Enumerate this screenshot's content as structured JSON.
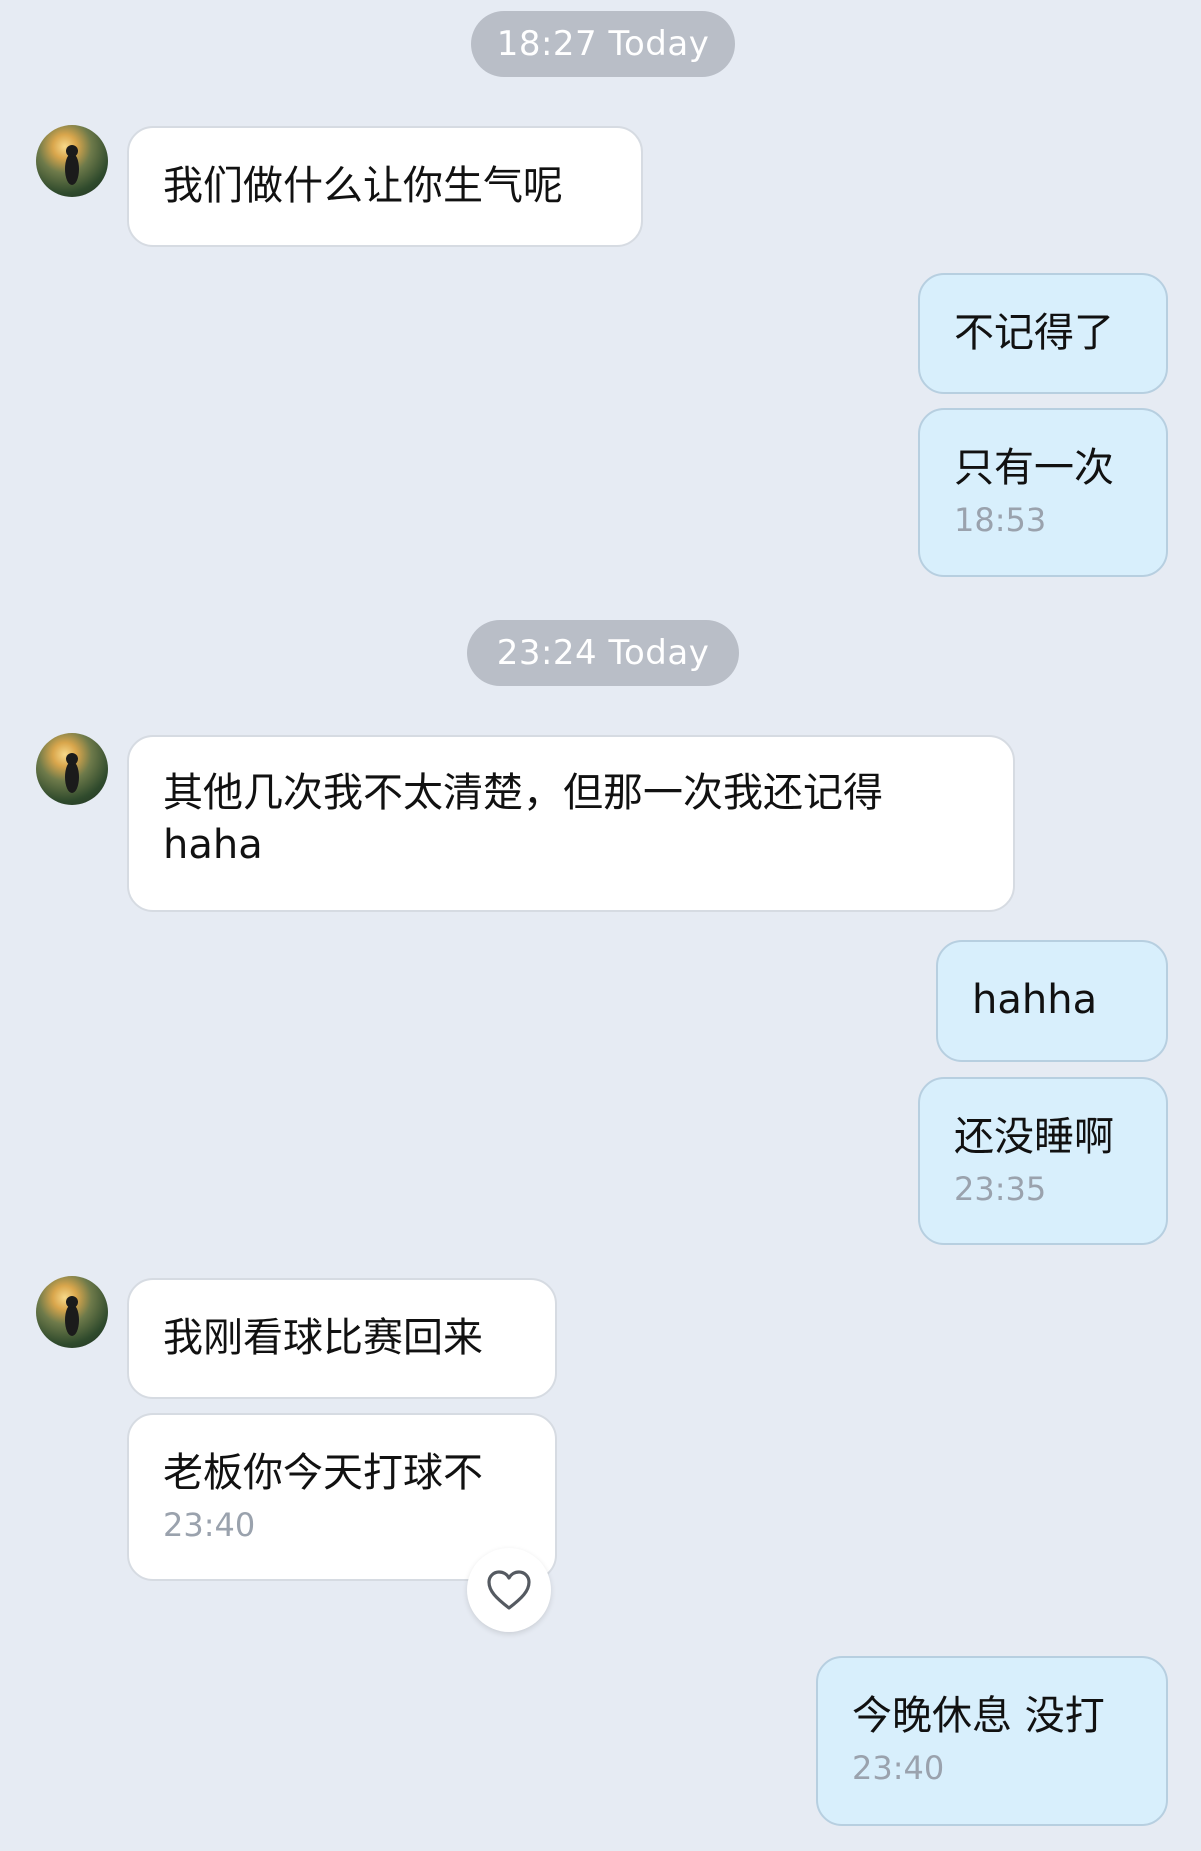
{
  "separators": [
    {
      "time": "18:27",
      "day": "Today",
      "text": "18:27 Today"
    },
    {
      "time": "23:24",
      "day": "Today",
      "text": "23:24 Today"
    }
  ],
  "messages": [
    {
      "id": "m1",
      "side": "incoming",
      "text": "我们做什么让你生气呢",
      "time": ""
    },
    {
      "id": "m2",
      "side": "outgoing",
      "text": "不记得了",
      "time": ""
    },
    {
      "id": "m3",
      "side": "outgoing",
      "text": "只有一次",
      "time": "18:53"
    },
    {
      "id": "m4",
      "side": "incoming",
      "text": "其他几次我不太清楚，但那一次我还记得\nhaha",
      "time": ""
    },
    {
      "id": "m5",
      "side": "outgoing",
      "text": "hahha",
      "time": ""
    },
    {
      "id": "m6",
      "side": "outgoing",
      "text": "还没睡啊",
      "time": "23:35"
    },
    {
      "id": "m7",
      "side": "incoming",
      "text": "我刚看球比赛回来",
      "time": ""
    },
    {
      "id": "m8",
      "side": "incoming",
      "text": "老板你今天打球不",
      "time": "23:40"
    },
    {
      "id": "m9",
      "side": "outgoing",
      "text": "今晚休息 没打",
      "time": "23:40"
    }
  ],
  "reaction": {
    "icon": "heart-outline-icon",
    "target": "m8"
  },
  "colors": {
    "background": "#e6ebf3",
    "incoming_bubble": "#ffffff",
    "outgoing_bubble": "#d8effc",
    "separator_pill": "#b9bec7",
    "timestamp_text": "#9aa2ad"
  }
}
